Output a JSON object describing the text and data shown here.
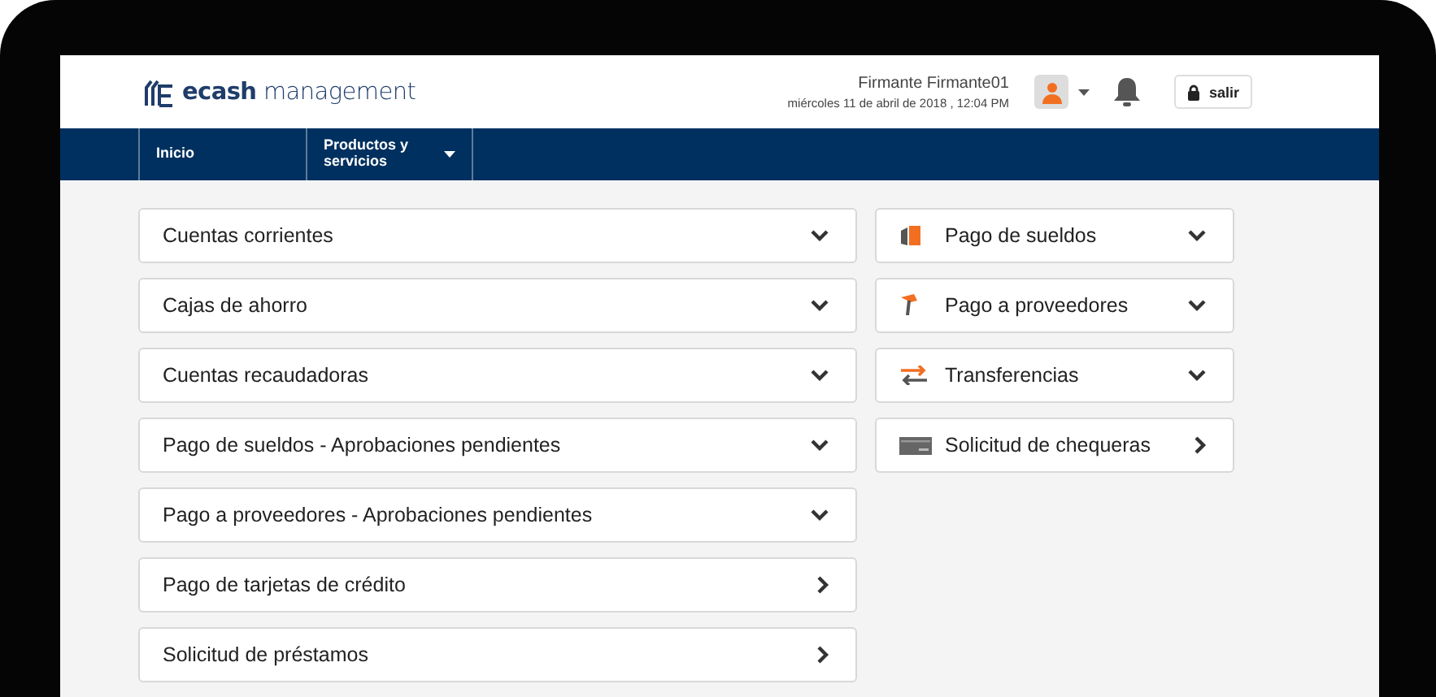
{
  "header": {
    "logo": {
      "bold": "ecash",
      "light": "management"
    },
    "user_name": "Firmante Firmante01",
    "datetime": "miércoles 11 de abril de 2018 , 12:04 PM",
    "logout": "salir"
  },
  "nav": [
    {
      "label": "Inicio",
      "dropdown": false
    },
    {
      "label": "Productos y servicios",
      "dropdown": true
    }
  ],
  "left_items": [
    {
      "label": "Cuentas corrientes",
      "kind": "expand"
    },
    {
      "label": "Cajas de ahorro",
      "kind": "expand"
    },
    {
      "label": "Cuentas recaudadoras",
      "kind": "expand"
    },
    {
      "label": "Pago de sueldos - Aprobaciones pendientes",
      "kind": "expand"
    },
    {
      "label": "Pago a proveedores - Aprobaciones pendientes",
      "kind": "expand"
    },
    {
      "label": "Pago de tarjetas de crédito",
      "kind": "link"
    },
    {
      "label": "Solicitud de préstamos",
      "kind": "link"
    }
  ],
  "right_items": [
    {
      "label": "Pago de sueldos",
      "kind": "expand"
    },
    {
      "label": "Pago a proveedores",
      "kind": "expand"
    },
    {
      "label": "Transferencias",
      "kind": "expand"
    },
    {
      "label": "Solicitud de chequeras",
      "kind": "link"
    }
  ]
}
